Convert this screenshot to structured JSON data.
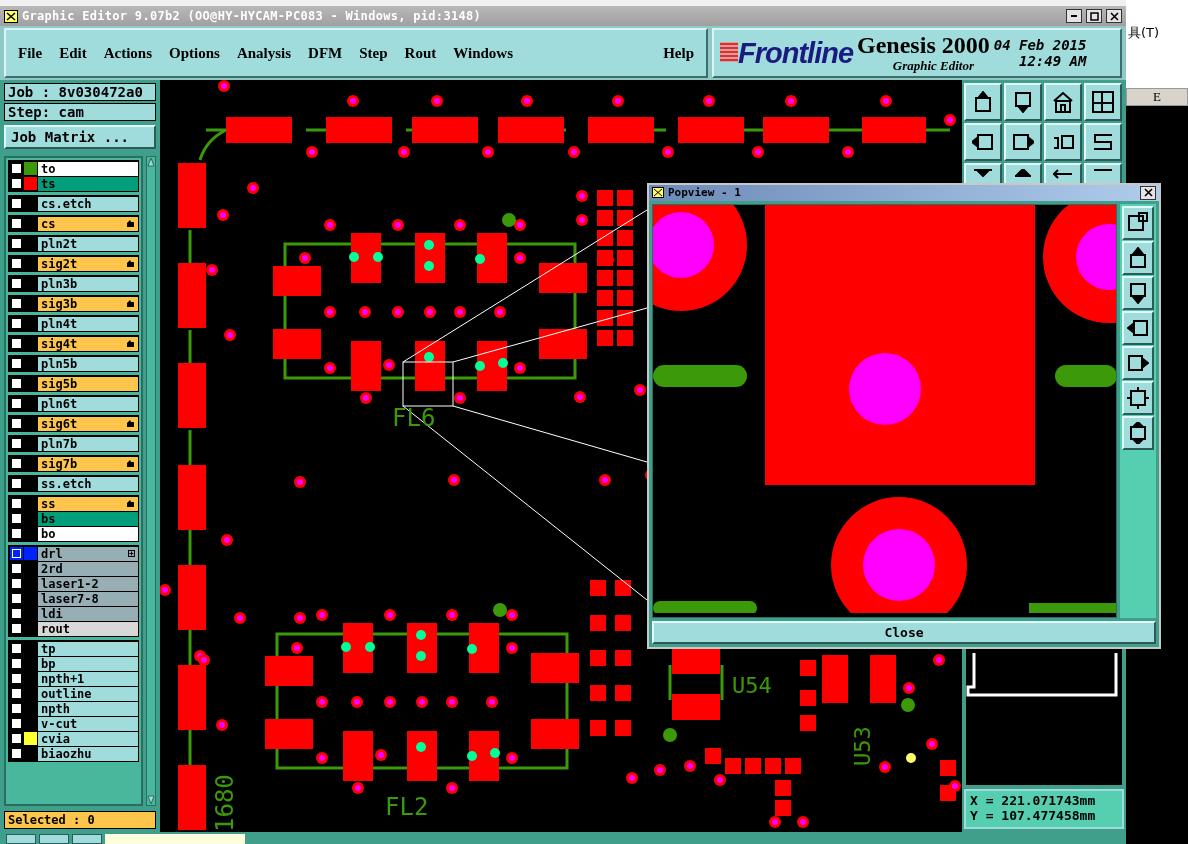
{
  "window": {
    "title": "Graphic Editor 9.07b2 (OO@HY-HYCAM-PC083 - Windows, pid:3148)"
  },
  "menu": [
    {
      "label": "File"
    },
    {
      "label": "Edit"
    },
    {
      "label": "Actions"
    },
    {
      "label": "Options"
    },
    {
      "label": "Analysis"
    },
    {
      "label": "DFM"
    },
    {
      "label": "Step"
    },
    {
      "label": "Rout"
    },
    {
      "label": "Windows"
    }
  ],
  "help": "Help",
  "brand": {
    "logo": "Frontline",
    "product": "Genesis 2000",
    "subtitle": "Graphic Editor",
    "date": "04 Feb 2015",
    "time": "12:49 AM"
  },
  "job": {
    "job": "Job : 8v030472a0",
    "step": "Step: cam",
    "matrix_button": "Job Matrix ..."
  },
  "layer_groups": [
    {
      "layers": [
        {
          "name": "to",
          "kind": "board",
          "color": "#3c9a0a",
          "affected": false,
          "focused": false
        },
        {
          "name": "ts",
          "kind": "solder",
          "color": "#ff0000",
          "affected": false,
          "focused": false
        }
      ]
    },
    {
      "layers": [
        {
          "name": "cs.etch",
          "kind": "misc",
          "affected": false,
          "focused": false
        }
      ]
    },
    {
      "layers": [
        {
          "name": "cs",
          "kind": "signal",
          "affected": true,
          "focused": false
        }
      ]
    },
    {
      "layers": [
        {
          "name": "pln2t",
          "kind": "misc",
          "affected": false,
          "focused": false
        }
      ]
    },
    {
      "layers": [
        {
          "name": "sig2t",
          "kind": "signal",
          "affected": true,
          "focused": false
        }
      ]
    },
    {
      "layers": [
        {
          "name": "pln3b",
          "kind": "misc",
          "affected": false,
          "focused": false
        }
      ]
    },
    {
      "layers": [
        {
          "name": "sig3b",
          "kind": "signal",
          "affected": true,
          "focused": false
        }
      ]
    },
    {
      "layers": [
        {
          "name": "pln4t",
          "kind": "misc",
          "affected": false,
          "focused": false
        }
      ]
    },
    {
      "layers": [
        {
          "name": "sig4t",
          "kind": "signal",
          "affected": true,
          "focused": false
        }
      ]
    },
    {
      "layers": [
        {
          "name": "pln5b",
          "kind": "misc",
          "affected": false,
          "focused": false
        }
      ]
    },
    {
      "layers": [
        {
          "name": "sig5b",
          "kind": "signal",
          "affected": false,
          "focused": false
        }
      ]
    },
    {
      "layers": [
        {
          "name": "pln6t",
          "kind": "misc",
          "affected": false,
          "focused": false
        }
      ]
    },
    {
      "layers": [
        {
          "name": "sig6t",
          "kind": "signal",
          "affected": true,
          "focused": false
        }
      ]
    },
    {
      "layers": [
        {
          "name": "pln7b",
          "kind": "misc",
          "affected": false,
          "focused": false
        }
      ]
    },
    {
      "layers": [
        {
          "name": "sig7b",
          "kind": "signal",
          "affected": true,
          "focused": false
        }
      ]
    },
    {
      "layers": [
        {
          "name": "ss.etch",
          "kind": "misc",
          "affected": false,
          "focused": false
        }
      ]
    },
    {
      "layers": [
        {
          "name": "ss",
          "kind": "signal",
          "affected": true,
          "focused": false
        },
        {
          "name": "bs",
          "kind": "solder",
          "affected": false,
          "focused": false
        },
        {
          "name": "bo",
          "kind": "board",
          "affected": false,
          "focused": false
        }
      ]
    },
    {
      "layers": [
        {
          "name": "drl",
          "kind": "drill",
          "color": "#0022ff",
          "affected": false,
          "focused": true
        },
        {
          "name": "2rd",
          "kind": "drill",
          "affected": false,
          "focused": false
        },
        {
          "name": "laser1-2",
          "kind": "drill",
          "affected": false,
          "focused": false
        },
        {
          "name": "laser7-8",
          "kind": "drill",
          "affected": false,
          "focused": false
        },
        {
          "name": "ldi",
          "kind": "drill",
          "affected": false,
          "focused": false
        },
        {
          "name": "rout",
          "kind": "rout",
          "affected": false,
          "focused": false
        }
      ]
    },
    {
      "layers": [
        {
          "name": "tp",
          "kind": "misc",
          "affected": false,
          "focused": false
        },
        {
          "name": "bp",
          "kind": "misc",
          "affected": false,
          "focused": false
        },
        {
          "name": "npth+1",
          "kind": "misc",
          "affected": false,
          "focused": false
        },
        {
          "name": "outline",
          "kind": "misc",
          "affected": false,
          "focused": false
        },
        {
          "name": "npth",
          "kind": "misc",
          "affected": false,
          "focused": false
        },
        {
          "name": "v-cut",
          "kind": "misc",
          "affected": false,
          "focused": false
        },
        {
          "name": "cvia",
          "kind": "misc",
          "color": "#ffff33",
          "affected": false,
          "focused": false
        },
        {
          "name": "biaozhu",
          "kind": "misc",
          "affected": false,
          "focused": false
        }
      ]
    }
  ],
  "selected_count": "Selected : 0",
  "canvas": {
    "labels": [
      {
        "text": "FL6",
        "kind": "horizontal"
      },
      {
        "text": "FL2",
        "kind": "horizontal"
      },
      {
        "text": "U54",
        "kind": "horizontal"
      },
      {
        "text": "U53",
        "kind": "vertical"
      },
      {
        "text": "1680",
        "kind": "vertical"
      }
    ]
  },
  "popview": {
    "title": "Popview - 1",
    "close_button": "Close"
  },
  "coordinates": {
    "x": "X = 221.071743mm",
    "y": "Y = 107.477458mm"
  },
  "background_app": {
    "menu_text": "具(T)",
    "column_header": "E"
  }
}
